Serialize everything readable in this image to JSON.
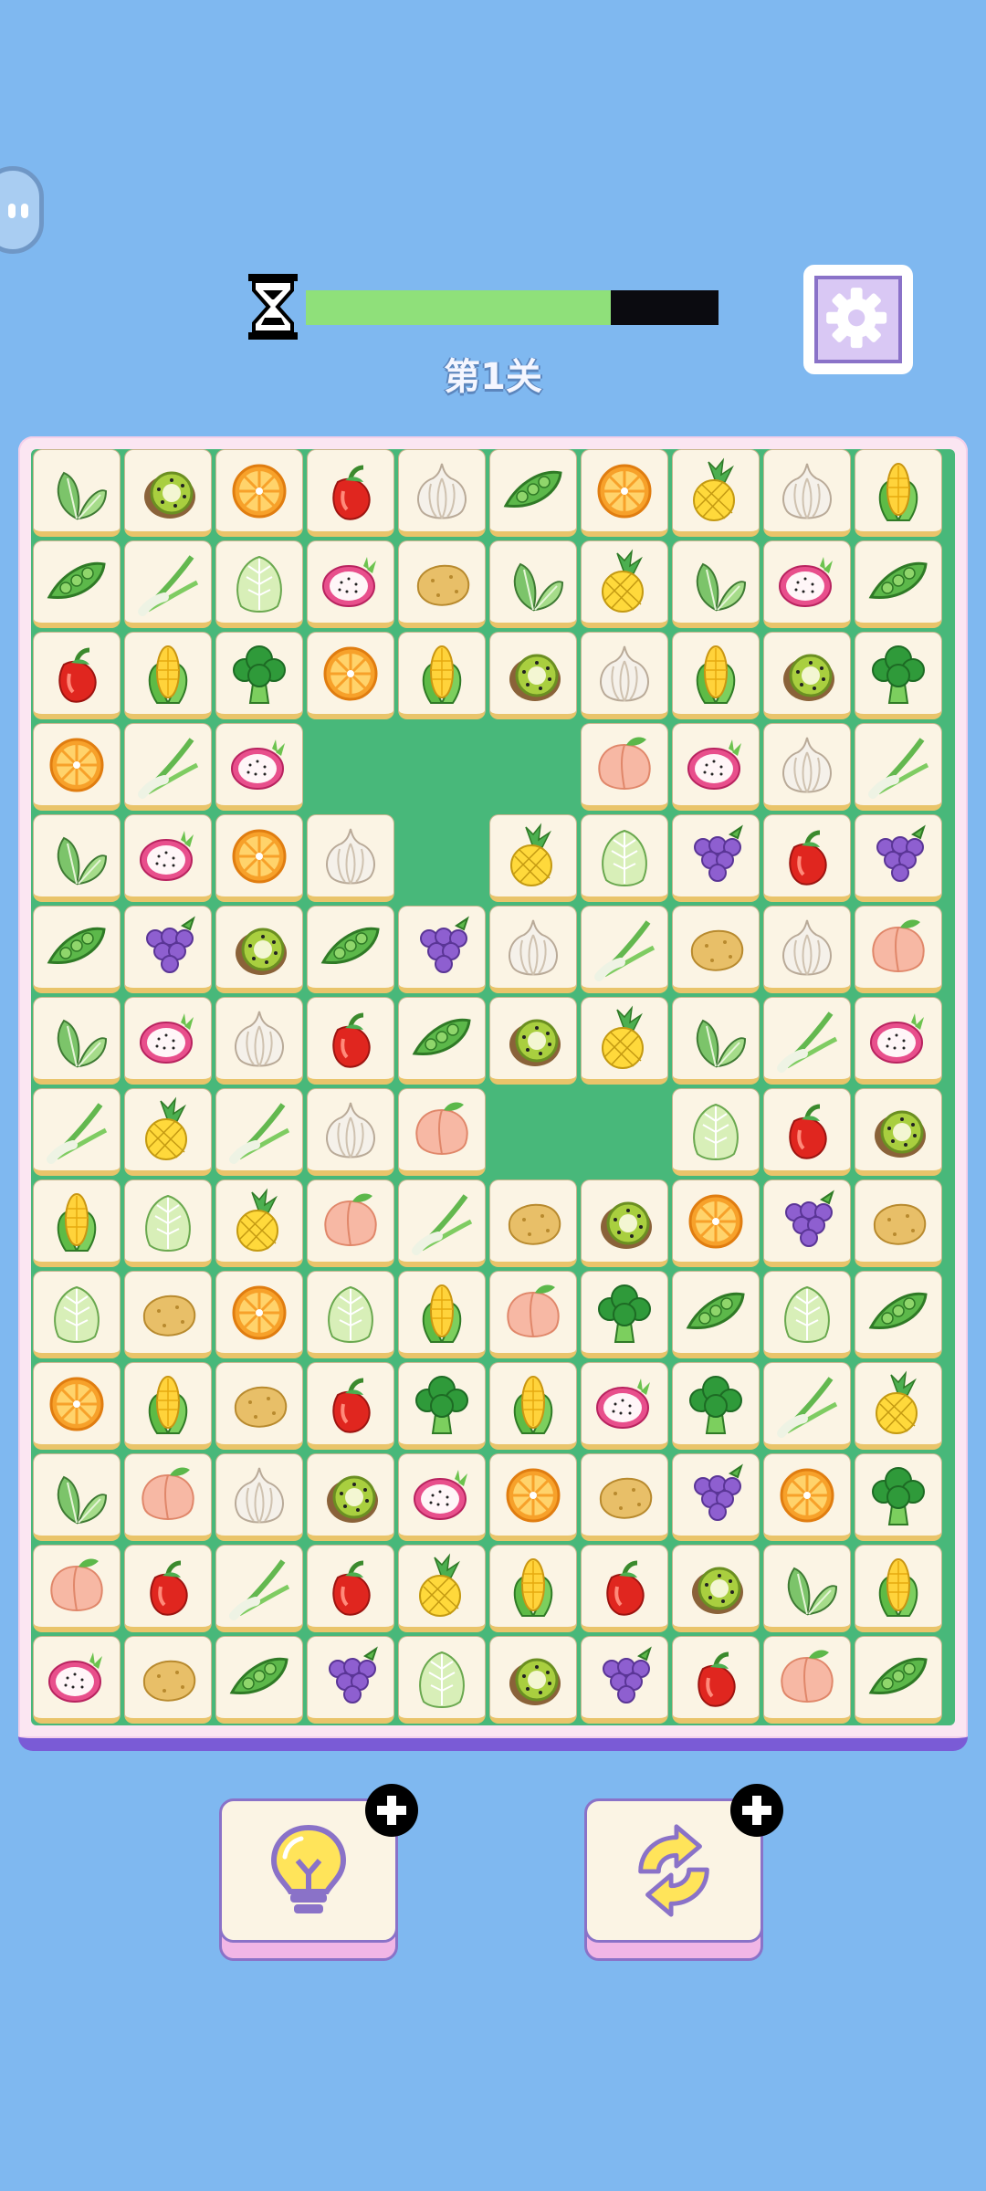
{
  "header": {
    "level_label": "第1关",
    "timer_remaining": 0.74
  },
  "colors": {
    "background": "#7fb8f0",
    "board_green": "#48b87a",
    "timer_fill": "#8fe07a",
    "accent_purple": "#8a72c8"
  },
  "board": {
    "rows": 14,
    "cols": 10,
    "grid": [
      [
        "spinach",
        "kiwi",
        "orange",
        "pepper",
        "garlic",
        "peas",
        "orange",
        "pineapple",
        "garlic",
        "corn"
      ],
      [
        "peas",
        "scallion",
        "cabbage",
        "dragonfruit",
        "potato",
        "spinach",
        "pineapple",
        "spinach",
        "dragonfruit",
        "peas"
      ],
      [
        "pepper",
        "corn",
        "broccoli",
        "orange",
        "corn",
        "kiwi",
        "garlic",
        "corn",
        "kiwi",
        "broccoli"
      ],
      [
        "orange",
        "scallion",
        "dragonfruit",
        null,
        null,
        null,
        "peach",
        "dragonfruit",
        "garlic",
        "scallion"
      ],
      [
        "spinach",
        "dragonfruit",
        "orange",
        "garlic",
        null,
        "pineapple",
        "cabbage",
        "grapes",
        "pepper",
        "grapes"
      ],
      [
        "peas",
        "grapes",
        "kiwi",
        "peas",
        "grapes",
        "garlic",
        "scallion",
        "potato",
        "garlic",
        "peach"
      ],
      [
        "spinach",
        "dragonfruit",
        "garlic",
        "pepper",
        "peas",
        "kiwi",
        "pineapple",
        "spinach",
        "scallion",
        "dragonfruit"
      ],
      [
        "scallion",
        "pineapple",
        "scallion",
        "garlic",
        "peach",
        null,
        null,
        "cabbage",
        "pepper",
        "kiwi"
      ],
      [
        "corn",
        "cabbage",
        "pineapple",
        "peach",
        "scallion",
        "potato",
        "kiwi",
        "orange",
        "grapes",
        "potato"
      ],
      [
        "cabbage",
        "potato",
        "orange",
        "cabbage",
        "corn",
        "peach",
        "broccoli",
        "peas",
        "cabbage",
        "peas"
      ],
      [
        "orange",
        "corn",
        "potato",
        "pepper",
        "broccoli",
        "corn",
        "dragonfruit",
        "broccoli",
        "scallion",
        "pineapple"
      ],
      [
        "spinach",
        "peach",
        "garlic",
        "kiwi",
        "dragonfruit",
        "orange",
        "potato",
        "grapes",
        "orange",
        "broccoli"
      ],
      [
        "peach",
        "pepper",
        "scallion",
        "pepper",
        "pineapple",
        "corn",
        "pepper",
        "kiwi",
        "spinach",
        "corn"
      ],
      [
        "dragonfruit",
        "potato",
        "peas",
        "grapes",
        "cabbage",
        "kiwi",
        "grapes",
        "pepper",
        "peach",
        "peas"
      ]
    ]
  },
  "tools": {
    "hint_icon": "lightbulb-icon",
    "shuffle_icon": "shuffle-icon",
    "add_icon": "plus-icon"
  }
}
